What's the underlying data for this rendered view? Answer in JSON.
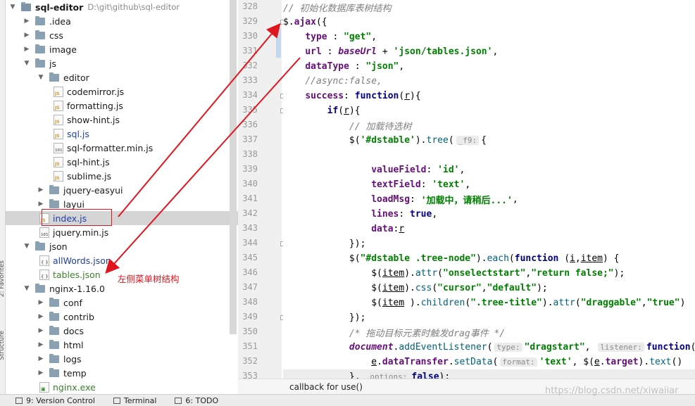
{
  "project": {
    "root_name": "sql-editor",
    "root_path": "D:\\git\\github\\sql-editor"
  },
  "tree": [
    {
      "label": "sql-editor",
      "type": "root",
      "indent": 0,
      "expanded": true
    },
    {
      "label": ".idea",
      "type": "folder",
      "indent": 1,
      "expanded": false
    },
    {
      "label": "css",
      "type": "folder",
      "indent": 1,
      "expanded": false
    },
    {
      "label": "image",
      "type": "folder",
      "indent": 1,
      "expanded": false
    },
    {
      "label": "js",
      "type": "folder",
      "indent": 1,
      "expanded": true
    },
    {
      "label": "editor",
      "type": "folder",
      "indent": 2,
      "expanded": true
    },
    {
      "label": "codemirror.js",
      "type": "js",
      "indent": 3
    },
    {
      "label": "formatting.js",
      "type": "js",
      "indent": 3
    },
    {
      "label": "show-hint.js",
      "type": "js",
      "indent": 3
    },
    {
      "label": "sql.js",
      "type": "js",
      "indent": 3,
      "color": "blue"
    },
    {
      "label": "sql-formatter.min.js",
      "type": "min",
      "indent": 3
    },
    {
      "label": "sql-hint.js",
      "type": "js",
      "indent": 3
    },
    {
      "label": "sublime.js",
      "type": "js",
      "indent": 3
    },
    {
      "label": "jquery-easyui",
      "type": "folder",
      "indent": 2,
      "expanded": false
    },
    {
      "label": "layui",
      "type": "folder",
      "indent": 2,
      "expanded": false
    },
    {
      "label": "index.js",
      "type": "js",
      "indent": 2,
      "color": "blue",
      "selected": true
    },
    {
      "label": "jquery.min.js",
      "type": "min",
      "indent": 2
    },
    {
      "label": "json",
      "type": "folder",
      "indent": 1,
      "expanded": true
    },
    {
      "label": "allWords.json",
      "type": "json",
      "indent": 2,
      "color": "blue"
    },
    {
      "label": "tables.json",
      "type": "json",
      "indent": 2,
      "color": "green"
    },
    {
      "label": "nginx-1.16.0",
      "type": "folder",
      "indent": 1,
      "expanded": true
    },
    {
      "label": "conf",
      "type": "folder",
      "indent": 2,
      "expanded": false
    },
    {
      "label": "contrib",
      "type": "folder",
      "indent": 2,
      "expanded": false
    },
    {
      "label": "docs",
      "type": "folder",
      "indent": 2,
      "expanded": false
    },
    {
      "label": "html",
      "type": "folder",
      "indent": 2,
      "expanded": false
    },
    {
      "label": "logs",
      "type": "folder",
      "indent": 2,
      "expanded": false
    },
    {
      "label": "temp",
      "type": "folder",
      "indent": 2,
      "expanded": false
    },
    {
      "label": "nginx.exe",
      "type": "exe",
      "indent": 2,
      "color": "green"
    }
  ],
  "annotation": {
    "text": "左侧菜单树结构",
    "color": "#e0161e"
  },
  "side_strip": {
    "labels": [
      "2: Favorites",
      "Structure"
    ]
  },
  "editor": {
    "line_numbers": [
      "328",
      "329",
      "330",
      "331",
      "332",
      "333",
      "334",
      "335",
      "336",
      "337",
      "338",
      "339",
      "340",
      "341",
      "342",
      "343",
      "344",
      "345",
      "346",
      "347",
      "348",
      "349",
      "350",
      "351",
      "352",
      "353"
    ],
    "fold_lines": [
      "329",
      "334",
      "335",
      "344",
      "349"
    ],
    "lines": [
      [
        {
          "t": "// 初始化数据库表树结构",
          "c": "cmt"
        }
      ],
      [
        {
          "t": "$.",
          "c": ""
        },
        {
          "t": "ajax",
          "c": "prop"
        },
        {
          "t": "({",
          "c": ""
        }
      ],
      [
        {
          "t": "    ",
          "c": ""
        },
        {
          "t": "type",
          "c": "prop"
        },
        {
          "t": " : ",
          "c": ""
        },
        {
          "t": "\"get\"",
          "c": "str"
        },
        {
          "t": ",",
          "c": ""
        }
      ],
      [
        {
          "t": "    ",
          "c": ""
        },
        {
          "t": "url",
          "c": "prop"
        },
        {
          "t": " : ",
          "c": ""
        },
        {
          "t": "baseUrl",
          "c": "glob"
        },
        {
          "t": " + ",
          "c": ""
        },
        {
          "t": "'json/tables.json'",
          "c": "str"
        },
        {
          "t": ",",
          "c": ""
        }
      ],
      [
        {
          "t": "    ",
          "c": ""
        },
        {
          "t": "dataType",
          "c": "prop"
        },
        {
          "t": " : ",
          "c": ""
        },
        {
          "t": "\"json\"",
          "c": "str"
        },
        {
          "t": ",",
          "c": ""
        }
      ],
      [
        {
          "t": "    ",
          "c": ""
        },
        {
          "t": "//async:false,",
          "c": "cmt"
        }
      ],
      [
        {
          "t": "    ",
          "c": ""
        },
        {
          "t": "success",
          "c": "prop"
        },
        {
          "t": ": ",
          "c": ""
        },
        {
          "t": "function",
          "c": "kw"
        },
        {
          "t": "(",
          "c": ""
        },
        {
          "t": "r",
          "c": "ul"
        },
        {
          "t": "){",
          "c": ""
        }
      ],
      [
        {
          "t": "        ",
          "c": ""
        },
        {
          "t": "if",
          "c": "kw"
        },
        {
          "t": "(",
          "c": ""
        },
        {
          "t": "r",
          "c": "ul"
        },
        {
          "t": "){",
          "c": ""
        }
      ],
      [
        {
          "t": "            ",
          "c": ""
        },
        {
          "t": "// 加载待选树",
          "c": "cmt"
        }
      ],
      [
        {
          "t": "            $(",
          "c": ""
        },
        {
          "t": "'#dstable'",
          "c": "str"
        },
        {
          "t": ").",
          "c": ""
        },
        {
          "t": "tree",
          "c": "fn"
        },
        {
          "t": "(",
          "c": ""
        },
        {
          "t": "_f9:",
          "c": "hint"
        },
        {
          "t": "{",
          "c": ""
        }
      ],
      [
        {
          "t": "",
          "c": ""
        }
      ],
      [
        {
          "t": "                ",
          "c": ""
        },
        {
          "t": "valueField",
          "c": "prop"
        },
        {
          "t": ": ",
          "c": ""
        },
        {
          "t": "'id'",
          "c": "str"
        },
        {
          "t": ",",
          "c": ""
        }
      ],
      [
        {
          "t": "                ",
          "c": ""
        },
        {
          "t": "textField",
          "c": "prop"
        },
        {
          "t": ": ",
          "c": ""
        },
        {
          "t": "'text'",
          "c": "str"
        },
        {
          "t": ",",
          "c": ""
        }
      ],
      [
        {
          "t": "                ",
          "c": ""
        },
        {
          "t": "loadMsg",
          "c": "prop"
        },
        {
          "t": ": ",
          "c": ""
        },
        {
          "t": "'加载中，请稍后...'",
          "c": "str"
        },
        {
          "t": ",",
          "c": ""
        }
      ],
      [
        {
          "t": "                ",
          "c": ""
        },
        {
          "t": "lines",
          "c": "prop"
        },
        {
          "t": ": ",
          "c": ""
        },
        {
          "t": "true",
          "c": "kw"
        },
        {
          "t": ",",
          "c": ""
        }
      ],
      [
        {
          "t": "                ",
          "c": ""
        },
        {
          "t": "data",
          "c": "prop"
        },
        {
          "t": ":",
          "c": ""
        },
        {
          "t": "r",
          "c": "ul"
        }
      ],
      [
        {
          "t": "            });",
          "c": ""
        }
      ],
      [
        {
          "t": "            $(",
          "c": ""
        },
        {
          "t": "\"#dstable .tree-node\"",
          "c": "str"
        },
        {
          "t": ").",
          "c": ""
        },
        {
          "t": "each",
          "c": "fn"
        },
        {
          "t": "(",
          "c": ""
        },
        {
          "t": "function",
          "c": "kw"
        },
        {
          "t": " (",
          "c": ""
        },
        {
          "t": "i",
          "c": "ul"
        },
        {
          "t": ",",
          "c": ""
        },
        {
          "t": "item",
          "c": "ul"
        },
        {
          "t": ") {",
          "c": ""
        }
      ],
      [
        {
          "t": "                $(",
          "c": ""
        },
        {
          "t": "item",
          "c": "ul"
        },
        {
          "t": ").",
          "c": ""
        },
        {
          "t": "attr",
          "c": "fn"
        },
        {
          "t": "(",
          "c": ""
        },
        {
          "t": "\"onselectstart\"",
          "c": "str"
        },
        {
          "t": ",",
          "c": ""
        },
        {
          "t": "\"return false;\"",
          "c": "str"
        },
        {
          "t": ");",
          "c": ""
        }
      ],
      [
        {
          "t": "                $(",
          "c": ""
        },
        {
          "t": "item",
          "c": "ul"
        },
        {
          "t": ").",
          "c": ""
        },
        {
          "t": "css",
          "c": "fn"
        },
        {
          "t": "(",
          "c": ""
        },
        {
          "t": "\"cursor\"",
          "c": "str"
        },
        {
          "t": ",",
          "c": ""
        },
        {
          "t": "\"default\"",
          "c": "str"
        },
        {
          "t": ");",
          "c": ""
        }
      ],
      [
        {
          "t": "                $(",
          "c": ""
        },
        {
          "t": "item",
          "c": "ul"
        },
        {
          "t": " ).",
          "c": ""
        },
        {
          "t": "children",
          "c": "fn"
        },
        {
          "t": "(",
          "c": ""
        },
        {
          "t": "\".tree-title\"",
          "c": "str"
        },
        {
          "t": ").",
          "c": ""
        },
        {
          "t": "attr",
          "c": "fn"
        },
        {
          "t": "(",
          "c": ""
        },
        {
          "t": "\"draggable\"",
          "c": "str"
        },
        {
          "t": ",",
          "c": ""
        },
        {
          "t": "\"true\"",
          "c": "str"
        },
        {
          "t": ")",
          "c": ""
        }
      ],
      [
        {
          "t": "            });",
          "c": ""
        }
      ],
      [
        {
          "t": "            ",
          "c": ""
        },
        {
          "t": "/* 拖动目标元素时触发drag事件 */",
          "c": "cmt"
        }
      ],
      [
        {
          "t": "            ",
          "c": ""
        },
        {
          "t": "document",
          "c": "glob"
        },
        {
          "t": ".",
          "c": ""
        },
        {
          "t": "addEventListener",
          "c": "fn"
        },
        {
          "t": "(",
          "c": ""
        },
        {
          "t": "type:",
          "c": "hint"
        },
        {
          "t": "\"dragstart\"",
          "c": "str"
        },
        {
          "t": ", ",
          "c": ""
        },
        {
          "t": "listener:",
          "c": "hint"
        },
        {
          "t": "function",
          "c": "kw"
        },
        {
          "t": "(",
          "c": ""
        }
      ],
      [
        {
          "t": "                ",
          "c": ""
        },
        {
          "t": "e",
          "c": "ul"
        },
        {
          "t": ".",
          "c": ""
        },
        {
          "t": "dataTransfer",
          "c": "prop"
        },
        {
          "t": ".",
          "c": ""
        },
        {
          "t": "setData",
          "c": "fn"
        },
        {
          "t": "(",
          "c": ""
        },
        {
          "t": "format:",
          "c": "hint"
        },
        {
          "t": "'text'",
          "c": "str"
        },
        {
          "t": ", $(",
          "c": ""
        },
        {
          "t": "e",
          "c": "ul"
        },
        {
          "t": ".",
          "c": ""
        },
        {
          "t": "target",
          "c": "prop"
        },
        {
          "t": ").",
          "c": ""
        },
        {
          "t": "text",
          "c": "fn"
        },
        {
          "t": "()",
          "c": ""
        }
      ],
      [
        {
          "t": "            }, ",
          "c": ""
        },
        {
          "t": "options:",
          "c": "hint"
        },
        {
          "t": "false",
          "c": "kw"
        },
        {
          "t": ");",
          "c": ""
        }
      ]
    ]
  },
  "breadcrumb": {
    "text": "callback for use()"
  },
  "statusbar": {
    "tools": [
      {
        "label": "9: Version Control",
        "icon": "version-control-icon"
      },
      {
        "label": "Terminal",
        "icon": "terminal-icon"
      },
      {
        "label": "6: TODO",
        "icon": "todo-icon"
      }
    ]
  },
  "watermark": {
    "text": "https://blog.csdn.net/xiwaiiar"
  }
}
